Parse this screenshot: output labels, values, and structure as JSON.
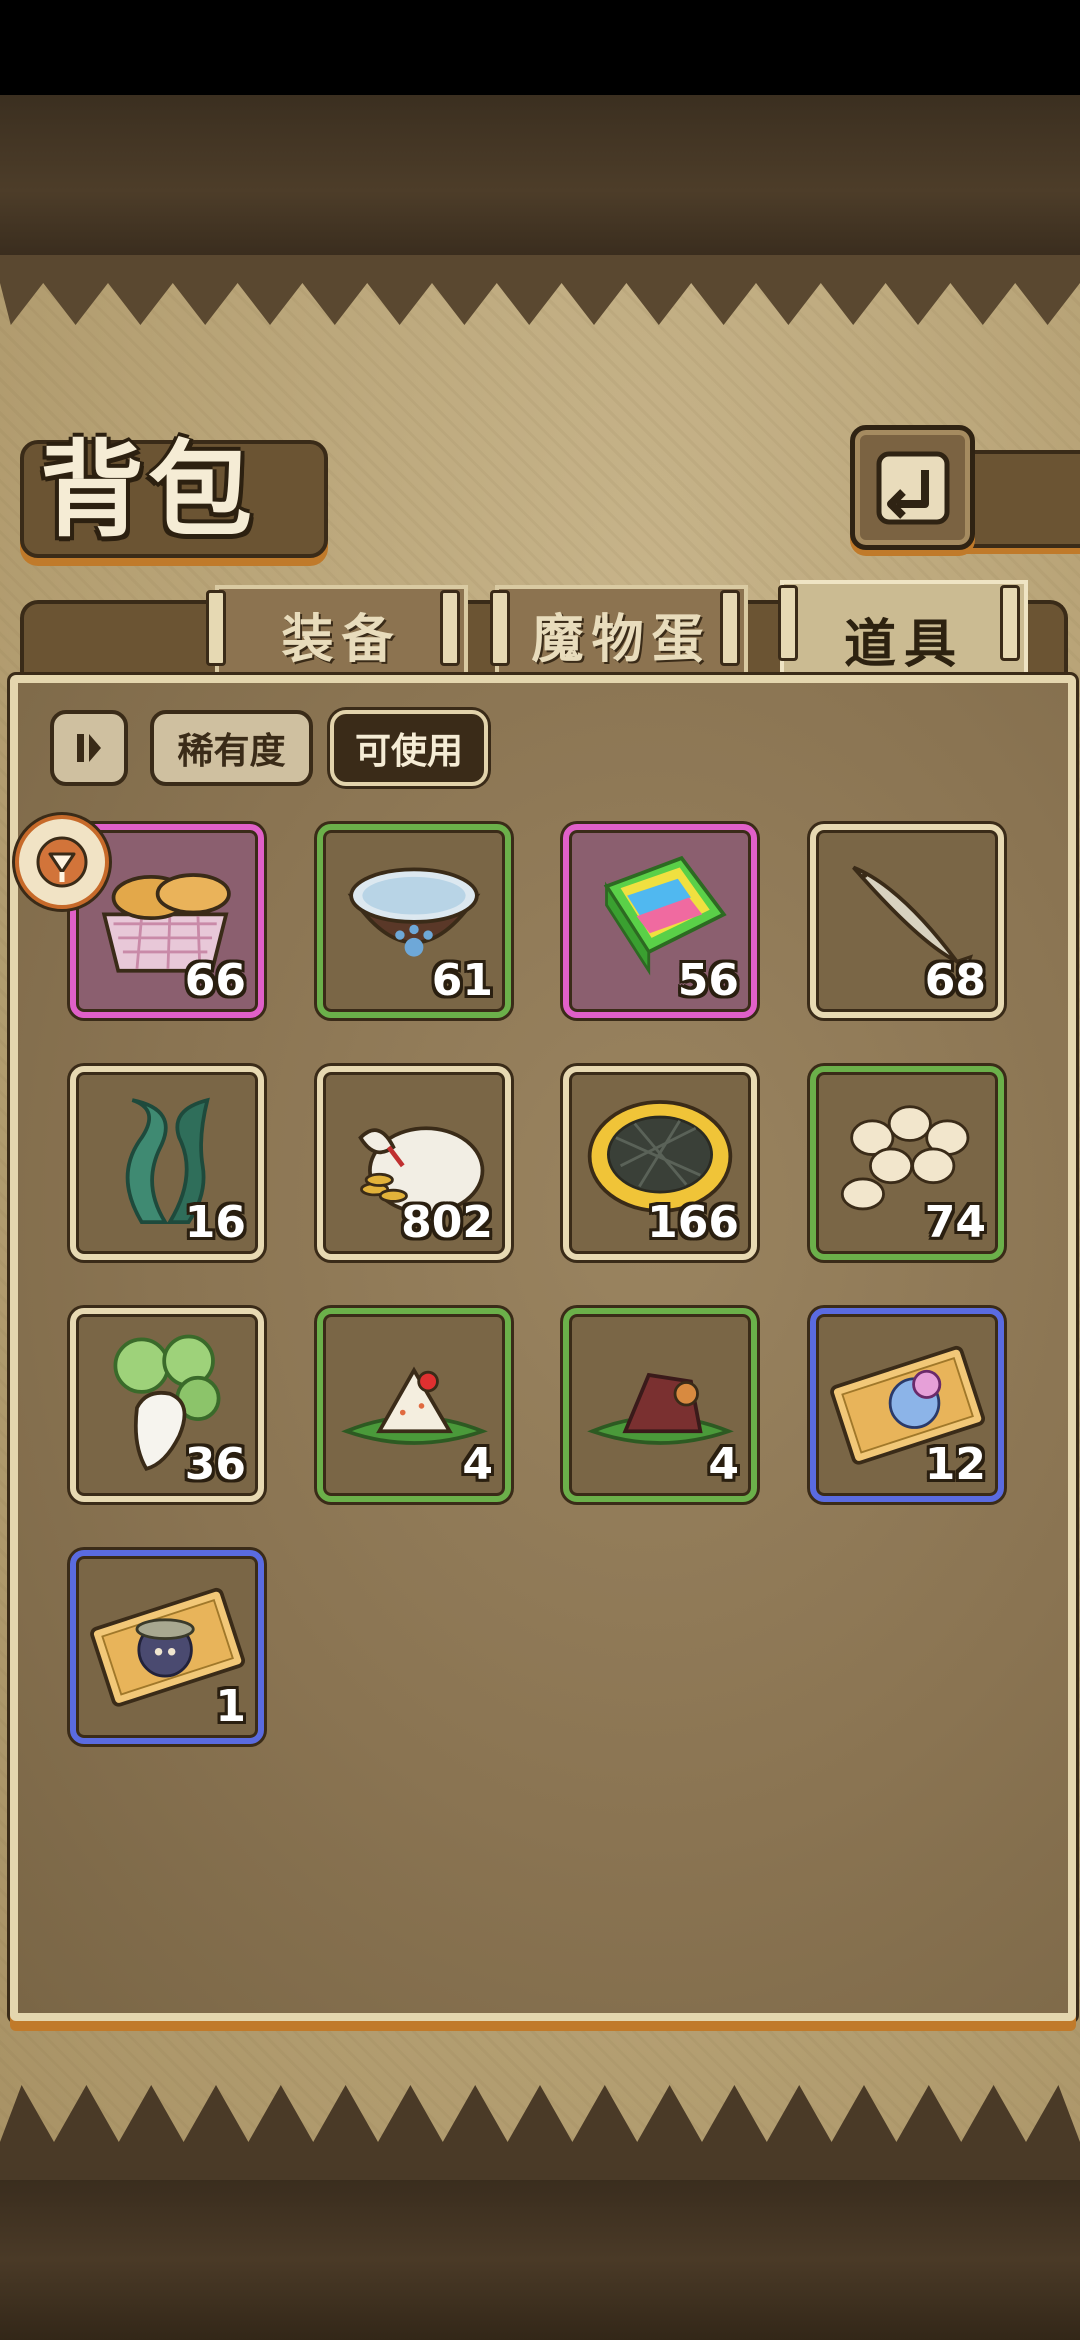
{
  "header": {
    "title": "背包",
    "back_icon": "return-arrow-icon"
  },
  "tabs": [
    {
      "label": "装备",
      "active": false
    },
    {
      "label": "魔物蛋",
      "active": false
    },
    {
      "label": "道具",
      "active": true
    }
  ],
  "filters": {
    "toggle_icon": "pause-toggle-icon",
    "rarity": "稀有度",
    "usable": "可使用"
  },
  "side_marker_icon": "arrow-badge-icon",
  "items": [
    {
      "icon": "bread-basket-icon",
      "count": "66",
      "rarity": "pink"
    },
    {
      "icon": "water-bowl-icon",
      "count": "61",
      "rarity": "green"
    },
    {
      "icon": "rainbow-cake-icon",
      "count": "56",
      "rarity": "pink"
    },
    {
      "icon": "fish-icon",
      "count": "68",
      "rarity": "cream"
    },
    {
      "icon": "seaweed-icon",
      "count": "16",
      "rarity": "cream"
    },
    {
      "icon": "coin-bag-icon",
      "count": "802",
      "rarity": "cream"
    },
    {
      "icon": "grilled-pie-icon",
      "count": "166",
      "rarity": "cream"
    },
    {
      "icon": "eggs-icon",
      "count": "74",
      "rarity": "green"
    },
    {
      "icon": "radish-icon",
      "count": "36",
      "rarity": "cream"
    },
    {
      "icon": "rice-dumpling-icon",
      "count": "4",
      "rarity": "green"
    },
    {
      "icon": "meat-dumpling-icon",
      "count": "4",
      "rarity": "green"
    },
    {
      "icon": "monster-ticket-icon",
      "count": "12",
      "rarity": "blue"
    },
    {
      "icon": "character-ticket-icon",
      "count": "1",
      "rarity": "blue"
    }
  ],
  "colors": {
    "green_frame": "#6bb04a",
    "pink_frame": "#e060c8",
    "blue_frame": "#5a6be0",
    "cream_frame": "#e7d9b2",
    "accent_orange": "#c07a2a"
  }
}
